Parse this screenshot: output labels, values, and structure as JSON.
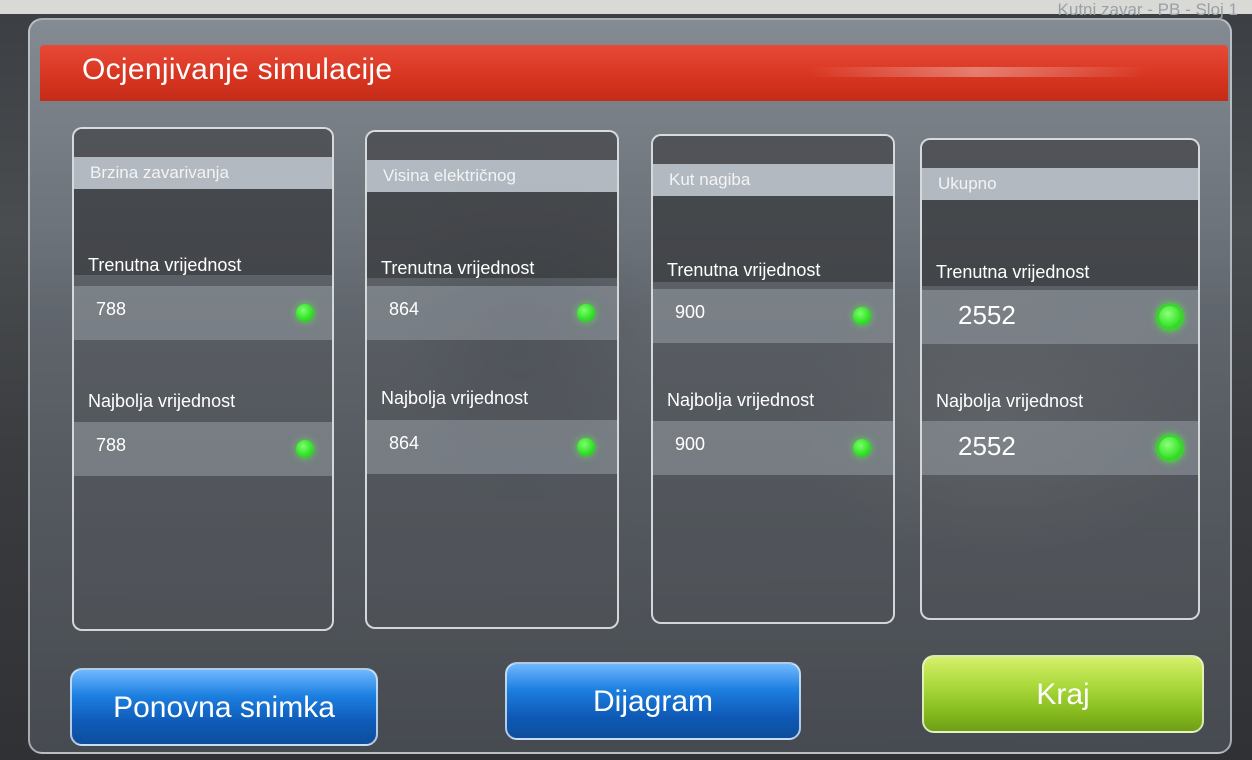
{
  "corner": {
    "text": "Kutni zavar - PB - Sloj 1"
  },
  "title": "Ocjenjivanje simulacije",
  "cards": [
    {
      "header": "Brzina zavarivanja",
      "current_label": "Trenutna vrijednost",
      "current_value": "788",
      "best_label": "Najbolja vrijednost",
      "best_value": "788",
      "status_color": "#34e22a"
    },
    {
      "header": "Visina električnog",
      "current_label": "Trenutna vrijednost",
      "current_value": "864",
      "best_label": "Najbolja vrijednost",
      "best_value": "864",
      "status_color": "#34e22a"
    },
    {
      "header": "Kut nagiba",
      "current_label": "Trenutna vrijednost",
      "current_value": "900",
      "best_label": "Najbolja vrijednost",
      "best_value": "900",
      "status_color": "#34e22a"
    },
    {
      "header": "Ukupno",
      "current_label": "Trenutna vrijednost",
      "current_value": "2552",
      "best_label": "Najbolja vrijednost",
      "best_value": "2552",
      "status_color": "#34e22a"
    }
  ],
  "buttons": {
    "replay": "Ponovna snimka",
    "diagram": "Dijagram",
    "end": "Kraj"
  },
  "colors": {
    "title_bar": "#d6341f",
    "button_blue": "#1c7fe0",
    "button_green": "#a9d83a",
    "status_ok": "#34e22a"
  },
  "icons": {
    "status": "status-dot-icon"
  }
}
